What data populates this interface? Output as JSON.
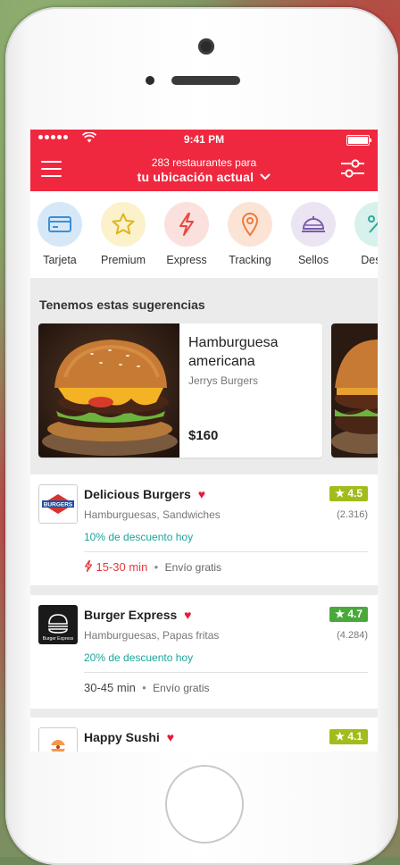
{
  "status": {
    "time": "9:41 PM"
  },
  "header": {
    "subtitle": "283 restaurantes para",
    "location": "tu ubicación actual"
  },
  "categories": [
    {
      "label": "Tarjeta",
      "icon": "card-icon",
      "bg": "#d6e8f8",
      "color": "#3a8fd8"
    },
    {
      "label": "Premium",
      "icon": "star-icon",
      "bg": "#fbf2cc",
      "color": "#e3b21c"
    },
    {
      "label": "Express",
      "icon": "bolt-icon",
      "bg": "#fbe1dd",
      "color": "#e8483d"
    },
    {
      "label": "Tracking",
      "icon": "pin-icon",
      "bg": "#fbe4d6",
      "color": "#ef7a3a"
    },
    {
      "label": "Sellos",
      "icon": "cloche-icon",
      "bg": "#eae4f3",
      "color": "#7a5ba8"
    },
    {
      "label": "Descu",
      "icon": "percent-icon",
      "bg": "#d8f1ec",
      "color": "#2bab98"
    }
  ],
  "suggestions": {
    "title": "Tenemos estas sugerencias",
    "items": [
      {
        "name": "Hamburguesa americana",
        "restaurant": "Jerrys Burgers",
        "price": "$160"
      }
    ]
  },
  "restaurants": [
    {
      "name": "Delicious Burgers",
      "categories": "Hamburguesas, Sandwiches",
      "discount": "10% de descuento hoy",
      "rating": "4.5",
      "reviews": "(2.316)",
      "time": "15-30 min",
      "shipping": "Envío gratis",
      "logo_text": "BURGERS",
      "rating_color": "#a3bc1b"
    },
    {
      "name": "Burger Express",
      "categories": "Hamburguesas, Papas fritas",
      "discount": "20% de descuento hoy",
      "rating": "4.7",
      "reviews": "(4.284)",
      "time": "30-45 min",
      "shipping": "Envío gratis",
      "logo_text": "Burger Express",
      "rating_color": "#4aa83b"
    },
    {
      "name": "Happy Sushi",
      "rating": "4.1",
      "rating_color": "#a3bc1b"
    }
  ],
  "colors": {
    "brand": "#f0283f",
    "accent_teal": "#1aa69a",
    "heart": "#e51b3a"
  }
}
